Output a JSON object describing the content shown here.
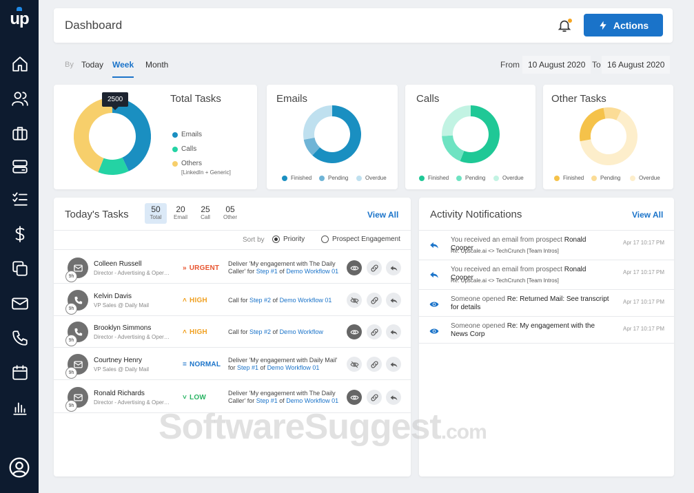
{
  "app": {
    "logo": "up"
  },
  "sidebar": {
    "icons": [
      "home-icon",
      "users-icon",
      "briefcase-icon",
      "inbox-icon",
      "checklist-icon",
      "dollar-icon",
      "copy-icon",
      "mail-icon",
      "phone-icon",
      "calendar-icon",
      "bar-chart-icon"
    ],
    "profile_icon": "user-circle-icon"
  },
  "header": {
    "title": "Dashboard",
    "actions_label": "Actions"
  },
  "filter": {
    "by_label": "By",
    "tabs": [
      {
        "label": "Today"
      },
      {
        "label": "Week",
        "active": true
      },
      {
        "label": "Month"
      }
    ],
    "from_label": "From",
    "from_value": "10 August 2020",
    "to_label": "To",
    "to_value": "16 August 2020"
  },
  "total_tasks": {
    "title": "Total Tasks",
    "tooltip": "2500",
    "legend": [
      {
        "label": "Emails",
        "color": "#1a8fc1"
      },
      {
        "label": "Calls",
        "color": "#24d3a4"
      },
      {
        "label": "Others",
        "color": "#f7cf6b"
      }
    ],
    "legend_note": "[LinkedIn + Generic]"
  },
  "stats": [
    {
      "title": "Emails",
      "legend": [
        "Finished",
        "Pending",
        "Overdue"
      ],
      "colors": [
        "#1a8fc1",
        "#6fb4d6",
        "#bfe0ef"
      ]
    },
    {
      "title": "Calls",
      "legend": [
        "Finished",
        "Pending",
        "Overdue"
      ],
      "colors": [
        "#1fc896",
        "#6ee3c2",
        "#c2f3e3"
      ]
    },
    {
      "title": "Other Tasks",
      "legend": [
        "Finished",
        "Pending",
        "Overdue"
      ],
      "colors": [
        "#f5c24a",
        "#fbdc96",
        "#fdeecb"
      ]
    }
  ],
  "chart_data": [
    {
      "type": "pie",
      "title": "Total Tasks",
      "categories": [
        "Emails",
        "Calls",
        "Others"
      ],
      "values": [
        43,
        13,
        44
      ]
    },
    {
      "type": "pie",
      "title": "Emails",
      "categories": [
        "Finished",
        "Pending",
        "Overdue"
      ],
      "values": [
        62,
        10,
        28
      ]
    },
    {
      "type": "pie",
      "title": "Calls",
      "categories": [
        "Finished",
        "Pending",
        "Overdue"
      ],
      "values": [
        56,
        18,
        26
      ]
    },
    {
      "type": "pie",
      "title": "Other Tasks",
      "categories": [
        "Finished",
        "Pending",
        "Overdue"
      ],
      "values": [
        25,
        10,
        65
      ]
    }
  ],
  "todays_tasks": {
    "title": "Today's Tasks",
    "view_all": "View All",
    "counts": [
      {
        "n": "50",
        "label": "Total",
        "active": true
      },
      {
        "n": "20",
        "label": "Email"
      },
      {
        "n": "25",
        "label": "Call"
      },
      {
        "n": "05",
        "label": "Other"
      }
    ],
    "sort_label": "Sort by",
    "sort_options": [
      {
        "label": "Priority",
        "selected": true
      },
      {
        "label": "Prospect Engagement",
        "selected": false
      }
    ],
    "rows": [
      {
        "type": "email",
        "tz": "9h",
        "name": "Colleen Russell",
        "role": "Director - Advertising & Operations",
        "priority": "URGENT",
        "prio_symbol": "»",
        "prio_color": "#e8542f",
        "desc_pre": "Deliver 'My engagement with The Daily Caller' for ",
        "step": "Step #1",
        "desc_mid": " of ",
        "workflow": "Demo Workflow 01",
        "view_state": "on"
      },
      {
        "type": "call",
        "tz": "9h",
        "name": "Kelvin Davis",
        "role": "VP Sales @ Daily Mail",
        "priority": "HIGH",
        "prio_symbol": "˄",
        "prio_color": "#f0a020",
        "desc_pre": "Call for  ",
        "step": "Step #2",
        "desc_mid": " of ",
        "workflow": "Demo Workflow 01",
        "view_state": "off"
      },
      {
        "type": "call",
        "tz": "9h",
        "name": "Brooklyn Simmons",
        "role": "Director - Advertising & Operations",
        "priority": "HIGH",
        "prio_symbol": "˄",
        "prio_color": "#f0a020",
        "desc_pre": "Call for ",
        "step": "Step #2",
        "desc_mid": " of ",
        "workflow": "Demo Workflow",
        "view_state": "on"
      },
      {
        "type": "email",
        "tz": "9h",
        "name": "Courtney Henry",
        "role": "VP Sales @ Daily Mail",
        "priority": "NORMAL",
        "prio_symbol": "=",
        "prio_color": "#1a73c9",
        "desc_pre": "Deliver 'My engagement with Daily Mail' for ",
        "step": "Step #1",
        "desc_mid": " of ",
        "workflow": "Demo Workflow 01",
        "view_state": "off"
      },
      {
        "type": "email",
        "tz": "9h",
        "name": "Ronald Richards",
        "role": "Director - Advertising & Operations",
        "priority": "LOW",
        "prio_symbol": "˅",
        "prio_color": "#28b463",
        "desc_pre": "Deliver 'My engagement with The Daily Caller' for ",
        "step": "Step #1",
        "desc_mid": " of ",
        "workflow": "Demo Workflow 01",
        "view_state": "on"
      }
    ]
  },
  "activity": {
    "title": "Activity Notifications",
    "view_all": "View All",
    "items": [
      {
        "icon": "reply-icon",
        "pre": "You received an email from prospect ",
        "bold": "Ronald Cooper",
        "sub": "Re: Upscale.ai <> TechCrunch [Team Intros]",
        "time": "Apr 17 10:17 PM"
      },
      {
        "icon": "reply-icon",
        "pre": "You received an email from prospect ",
        "bold": "Ronald Cooper",
        "sub": "Re: Upscale.ai <> TechCrunch [Team Intros]",
        "time": "Apr 17 10:17 PM"
      },
      {
        "icon": "eye-icon",
        "pre": "Someone opened ",
        "bold": "Re: Returned Mail: See transcript for details",
        "sub": "",
        "time": "Apr 17 10:17 PM"
      },
      {
        "icon": "eye-icon",
        "pre": "Someone opened ",
        "bold": "Re: My engagement with the News Corp",
        "sub": "",
        "time": "Apr 17 10:17 PM"
      }
    ]
  },
  "watermark": {
    "main": "SoftwareSuggest",
    "suffix": ".com"
  }
}
